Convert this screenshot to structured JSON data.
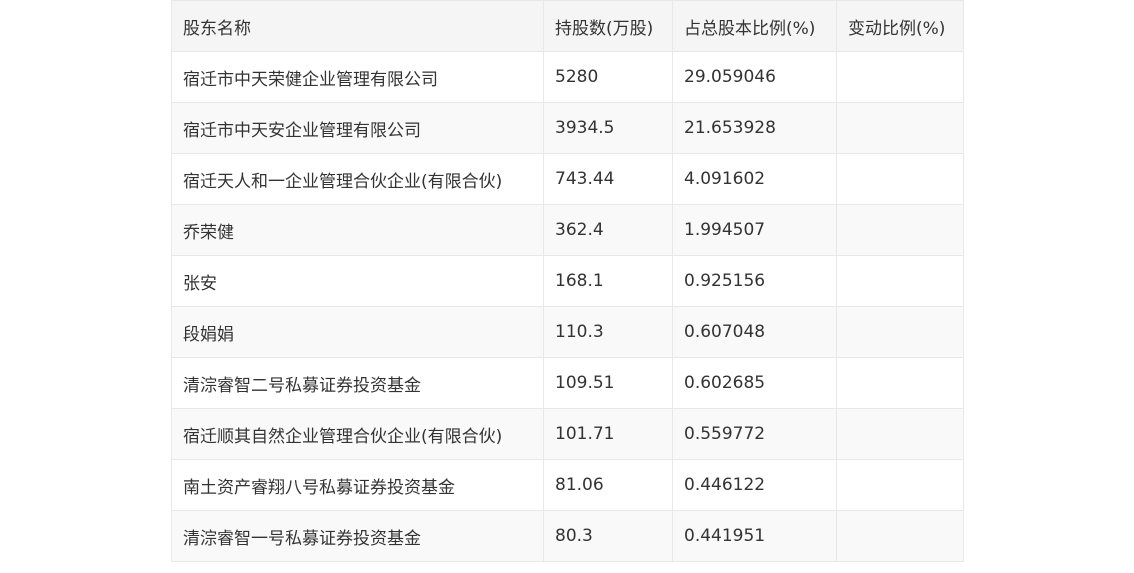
{
  "table": {
    "headers": [
      "股东名称",
      "持股数(万股)",
      "占总股本比例(%)",
      "变动比例(%)"
    ],
    "rows": [
      [
        "宿迁市中天荣健企业管理有限公司",
        "5280",
        "29.059046",
        ""
      ],
      [
        "宿迁市中天安企业管理有限公司",
        "3934.5",
        "21.653928",
        ""
      ],
      [
        "宿迁天人和一企业管理合伙企业(有限合伙)",
        "743.44",
        "4.091602",
        ""
      ],
      [
        "乔荣健",
        "362.4",
        "1.994507",
        ""
      ],
      [
        "张安",
        "168.1",
        "0.925156",
        ""
      ],
      [
        "段娟娟",
        "110.3",
        "0.607048",
        ""
      ],
      [
        "清淙睿智二号私募证券投资基金",
        "109.51",
        "0.602685",
        ""
      ],
      [
        "宿迁顺其自然企业管理合伙企业(有限合伙)",
        "101.71",
        "0.559772",
        ""
      ],
      [
        "南土资产睿翔八号私募证券投资基金",
        "81.06",
        "0.446122",
        ""
      ],
      [
        "清淙睿智一号私募证券投资基金",
        "80.3",
        "0.441951",
        ""
      ]
    ]
  }
}
